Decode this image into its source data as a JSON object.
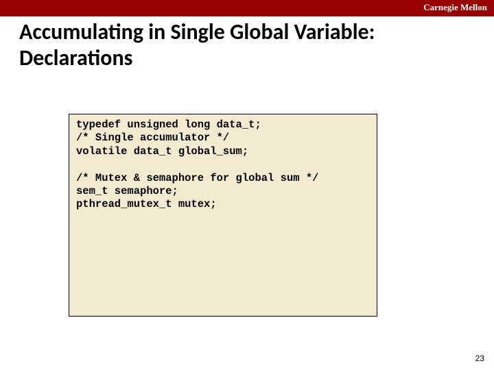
{
  "header": {
    "org": "Carnegie Mellon"
  },
  "title": "Accumulating in Single Global Variable: Declarations",
  "code": "typedef unsigned long data_t;\n/* Single accumulator */\nvolatile data_t global_sum;\n\n/* Mutex & semaphore for global sum */\nsem_t semaphore;\npthread_mutex_t mutex;",
  "page_number": "23"
}
